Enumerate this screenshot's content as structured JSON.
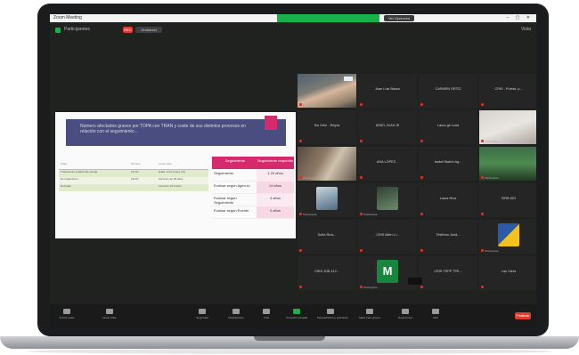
{
  "window": {
    "app_title": "Zoom Meeting",
    "controls": "– ▢ ✕",
    "view_button": "Ver Opciones"
  },
  "top": {
    "user": "Participantes",
    "rec_label": "REC",
    "rec_status": "Grabando",
    "view_label": "Vista"
  },
  "slide": {
    "heading": "Número afectados graves por TDPA con TRAN y coste de sus distintos procesos en relación con el seguimiento...",
    "table_headers": [
      "Edad",
      "Número",
      "Coste total"
    ],
    "table_rows": [
      [
        "Tratamiento establecido (Guía)",
        "22.0%",
        "Edad: 0-24 meses (%)"
      ],
      [
        "En tratamiento",
        "26.2%",
        "Atención de 38 años"
      ],
      [
        "Derivado",
        "",
        "Atención 10.9 años"
      ]
    ],
    "right_headers": [
      "Seguimiento",
      "Seguimiento requerido"
    ],
    "right_rows": [
      [
        "Seguimiento",
        "1-20 años"
      ],
      [
        "Evaluar según Agen-to",
        "14 años"
      ],
      [
        "Evaluar según Seguimiento",
        "4 años"
      ],
      [
        "Evaluar según Evento",
        "0 años"
      ]
    ]
  },
  "tiles": [
    {
      "name": "",
      "caption": "Participante",
      "type": "photo-man"
    },
    {
      "name": "Juan Luis Basso",
      "caption": "",
      "type": "name"
    },
    {
      "name": "CARMEN ORTIZ",
      "caption": "",
      "type": "name"
    },
    {
      "name": "CRIS - Puerta, p...",
      "caption": "",
      "type": "name"
    },
    {
      "name": "Sol Ortiz - Reyes",
      "caption": "",
      "type": "name"
    },
    {
      "name": "ARIEL JUAN IS",
      "caption": "",
      "type": "name"
    },
    {
      "name": "Laura gil Luna",
      "caption": "",
      "type": "name"
    },
    {
      "name": "",
      "caption": "Participante",
      "type": "photo-light"
    },
    {
      "name": "",
      "caption": "Participante",
      "type": "photo-room"
    },
    {
      "name": "ANA LÓPEZ...",
      "caption": "",
      "type": "name"
    },
    {
      "name": "Isabel Martín Ag...",
      "caption": "",
      "type": "name"
    },
    {
      "name": "",
      "caption": "Participante",
      "type": "photo-green"
    },
    {
      "name": "",
      "caption": "Participante",
      "type": "avatar-pic"
    },
    {
      "name": "",
      "caption": "Participante",
      "type": "avatar-pic2"
    },
    {
      "name": "Laura Ríos",
      "caption": "",
      "type": "name"
    },
    {
      "name": "ISRB 8Z2",
      "caption": "",
      "type": "name"
    },
    {
      "name": "Sofía Ríos...",
      "caption": "",
      "type": "name"
    },
    {
      "name": "CRIS Allén Li...",
      "caption": "",
      "type": "name"
    },
    {
      "name": "Teléfono Jurid...",
      "caption": "",
      "type": "name"
    },
    {
      "name": "",
      "caption": "Participante",
      "type": "avatar-logo"
    },
    {
      "name": "CRIS JOB 412...",
      "caption": "",
      "type": "name"
    },
    {
      "name": "",
      "caption": "Participante",
      "type": "avatar-m",
      "letter": "M"
    },
    {
      "name": "CRIS TSPP TPE...",
      "caption": "",
      "type": "name"
    },
    {
      "name": "Lau Viera",
      "caption": "",
      "type": "name"
    }
  ],
  "toolbar": {
    "items": [
      {
        "label": "Activar audio",
        "icon": "mic-icon"
      },
      {
        "label": "Iniciar video",
        "icon": "video-icon"
      },
      {
        "label": "Seguridad",
        "icon": "shield-icon"
      },
      {
        "label": "Participantes",
        "icon": "participants-icon"
      },
      {
        "label": "Chat",
        "icon": "chat-icon"
      },
      {
        "label": "Compartir pantalla",
        "icon": "share-screen-icon"
      },
      {
        "label": "Pausar/Detener grabación",
        "icon": "record-icon"
      },
      {
        "label": "Salas para grupos",
        "icon": "breakout-icon"
      },
      {
        "label": "Reacciones",
        "icon": "reactions-icon"
      },
      {
        "label": "Más",
        "icon": "more-icon"
      }
    ],
    "end_label": "Finalizar"
  },
  "colors": {
    "accent_green": "#19b24a",
    "record_red": "#e0392e",
    "slide_pink": "#d52b6c",
    "slide_navy": "#4a4d80"
  }
}
